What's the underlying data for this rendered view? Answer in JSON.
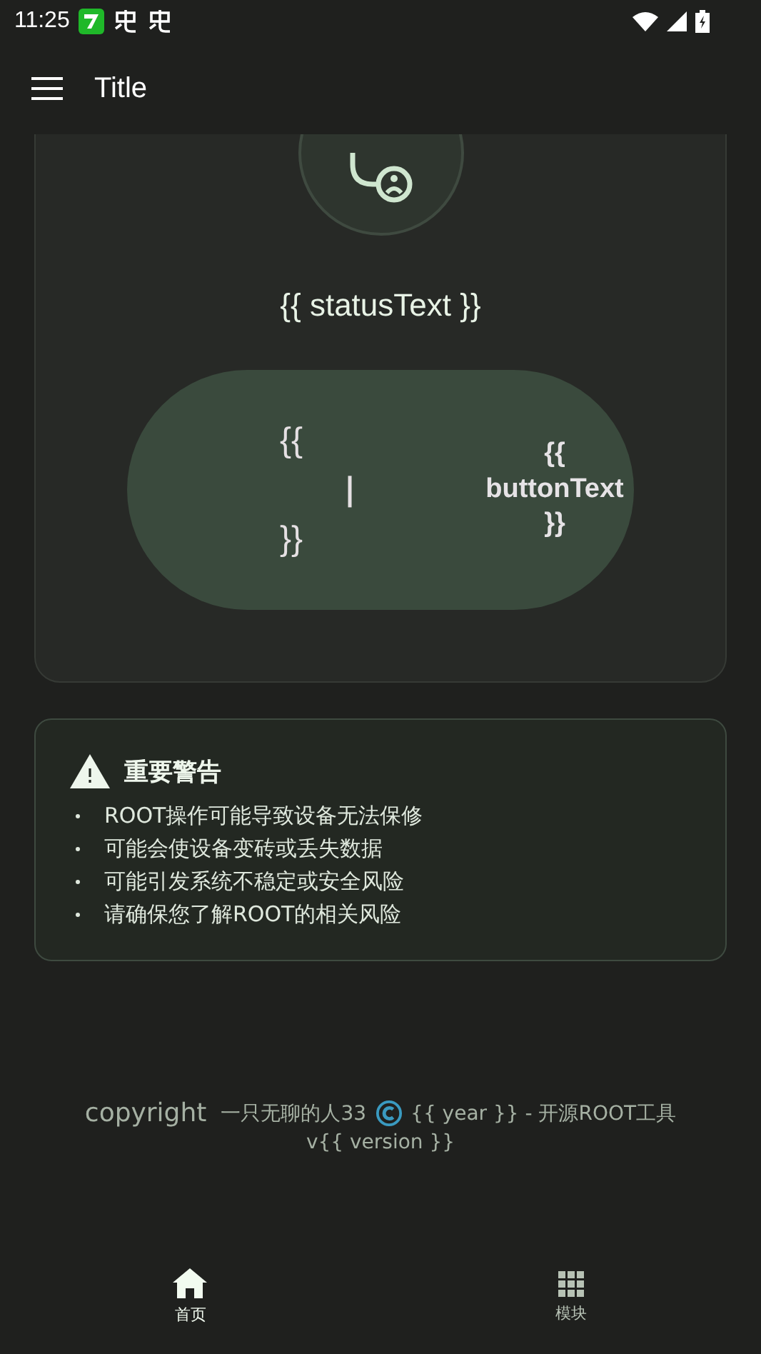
{
  "status_bar": {
    "time": "11:25"
  },
  "app_bar": {
    "title": "Title"
  },
  "status_card": {
    "status_text": "{{ statusText }}",
    "button": {
      "left_top": "{{",
      "left_middle": "|",
      "left_bottom": "}}",
      "label": "{{ buttonText }}"
    }
  },
  "warning": {
    "title": "重要警告",
    "items": [
      "ROOT操作可能导致设备无法保修",
      "可能会使设备变砖或丢失数据",
      "可能引发系统不稳定或安全风险",
      "请确保您了解ROOT的相关风险"
    ]
  },
  "footer": {
    "copyright_label": "copyright",
    "author": "一只无聊的人33",
    "tail": "{{ year }} - 开源ROOT工具",
    "version": "v{{ version }}"
  },
  "bottom_nav": [
    {
      "kind": "home",
      "label": "首页",
      "selected": true
    },
    {
      "kind": "modules",
      "label": "模块",
      "selected": false
    }
  ]
}
